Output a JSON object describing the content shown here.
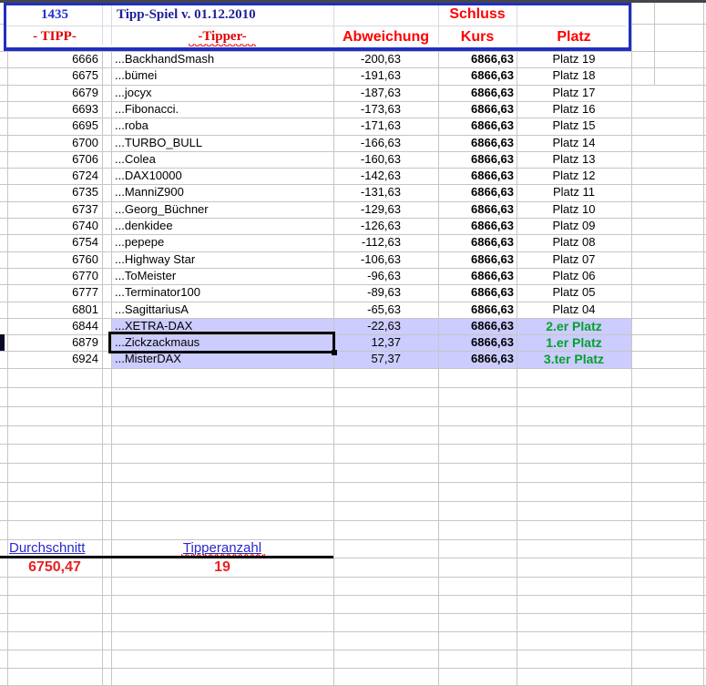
{
  "header": {
    "week_number": "1435",
    "title": "Tipp-Spiel v. 01.12.2010",
    "schluss_label": "Schluss",
    "col_tipp": "- TIPP-",
    "col_tipper": "-Tipper-",
    "col_abweichung": "Abweichung",
    "col_kurs": "Kurs",
    "col_platz": "Platz"
  },
  "rows": [
    {
      "tipp": "6666",
      "tipper": "...BackhandSmash",
      "abweichung": "-200,63",
      "kurs": "6866,63",
      "platz": "Platz 19",
      "highlighted": false,
      "winner": false,
      "selected": false
    },
    {
      "tipp": "6675",
      "tipper": "...bümei",
      "abweichung": "-191,63",
      "kurs": "6866,63",
      "platz": "Platz 18",
      "highlighted": false,
      "winner": false,
      "selected": false
    },
    {
      "tipp": "6679",
      "tipper": "...jocyx",
      "abweichung": "-187,63",
      "kurs": "6866,63",
      "platz": "Platz 17",
      "highlighted": false,
      "winner": false,
      "selected": false
    },
    {
      "tipp": "6693",
      "tipper": "...Fibonacci.",
      "abweichung": "-173,63",
      "kurs": "6866,63",
      "platz": "Platz 16",
      "highlighted": false,
      "winner": false,
      "selected": false
    },
    {
      "tipp": "6695",
      "tipper": "...roba",
      "abweichung": "-171,63",
      "kurs": "6866,63",
      "platz": "Platz 15",
      "highlighted": false,
      "winner": false,
      "selected": false
    },
    {
      "tipp": "6700",
      "tipper": "...TURBO_BULL",
      "abweichung": "-166,63",
      "kurs": "6866,63",
      "platz": "Platz 14",
      "highlighted": false,
      "winner": false,
      "selected": false
    },
    {
      "tipp": "6706",
      "tipper": "...Colea",
      "abweichung": "-160,63",
      "kurs": "6866,63",
      "platz": "Platz 13",
      "highlighted": false,
      "winner": false,
      "selected": false
    },
    {
      "tipp": "6724",
      "tipper": "...DAX10000",
      "abweichung": "-142,63",
      "kurs": "6866,63",
      "platz": "Platz 12",
      "highlighted": false,
      "winner": false,
      "selected": false
    },
    {
      "tipp": "6735",
      "tipper": "...ManniZ900",
      "abweichung": "-131,63",
      "kurs": "6866,63",
      "platz": "Platz 11",
      "highlighted": false,
      "winner": false,
      "selected": false
    },
    {
      "tipp": "6737",
      "tipper": "...Georg_Büchner",
      "abweichung": "-129,63",
      "kurs": "6866,63",
      "platz": "Platz 10",
      "highlighted": false,
      "winner": false,
      "selected": false
    },
    {
      "tipp": "6740",
      "tipper": "...denkidee",
      "abweichung": "-126,63",
      "kurs": "6866,63",
      "platz": "Platz 09",
      "highlighted": false,
      "winner": false,
      "selected": false
    },
    {
      "tipp": "6754",
      "tipper": "...pepepe",
      "abweichung": "-112,63",
      "kurs": "6866,63",
      "platz": "Platz 08",
      "highlighted": false,
      "winner": false,
      "selected": false
    },
    {
      "tipp": "6760",
      "tipper": "...Highway Star",
      "abweichung": "-106,63",
      "kurs": "6866,63",
      "platz": "Platz 07",
      "highlighted": false,
      "winner": false,
      "selected": false
    },
    {
      "tipp": "6770",
      "tipper": "...ToMeister",
      "abweichung": "-96,63",
      "kurs": "6866,63",
      "platz": "Platz 06",
      "highlighted": false,
      "winner": false,
      "selected": false
    },
    {
      "tipp": "6777",
      "tipper": "...Terminator100",
      "abweichung": "-89,63",
      "kurs": "6866,63",
      "platz": "Platz 05",
      "highlighted": false,
      "winner": false,
      "selected": false
    },
    {
      "tipp": "6801",
      "tipper": "...SagittariusA",
      "abweichung": "-65,63",
      "kurs": "6866,63",
      "platz": "Platz 04",
      "highlighted": false,
      "winner": false,
      "selected": false
    },
    {
      "tipp": "6844",
      "tipper": "...XETRA-DAX",
      "abweichung": "-22,63",
      "kurs": "6866,63",
      "platz": "2.er Platz",
      "highlighted": true,
      "winner": true,
      "selected": false
    },
    {
      "tipp": "6879",
      "tipper": "...Zickzackmaus",
      "abweichung": "12,37",
      "kurs": "6866,63",
      "platz": "1.er Platz",
      "highlighted": true,
      "winner": true,
      "selected": true
    },
    {
      "tipp": "6924",
      "tipper": "...MisterDAX",
      "abweichung": "57,37",
      "kurs": "6866,63",
      "platz": "3.ter Platz",
      "highlighted": true,
      "winner": true,
      "selected": false
    }
  ],
  "footer": {
    "durchschnitt_label": "Durchschnitt",
    "durchschnitt_value": "6750,47",
    "tipperanzahl_label": "Tipperanzahl",
    "tipperanzahl_value": "19"
  },
  "colors": {
    "highlight": "#ccccff",
    "winner_green": "#00a22b",
    "header_red": "#ff0000",
    "serif_red": "#e00000",
    "header_blue": "#2233cc",
    "title_navy": "#202099",
    "footer_blue": "#2929cc",
    "value_red": "#e82222"
  }
}
